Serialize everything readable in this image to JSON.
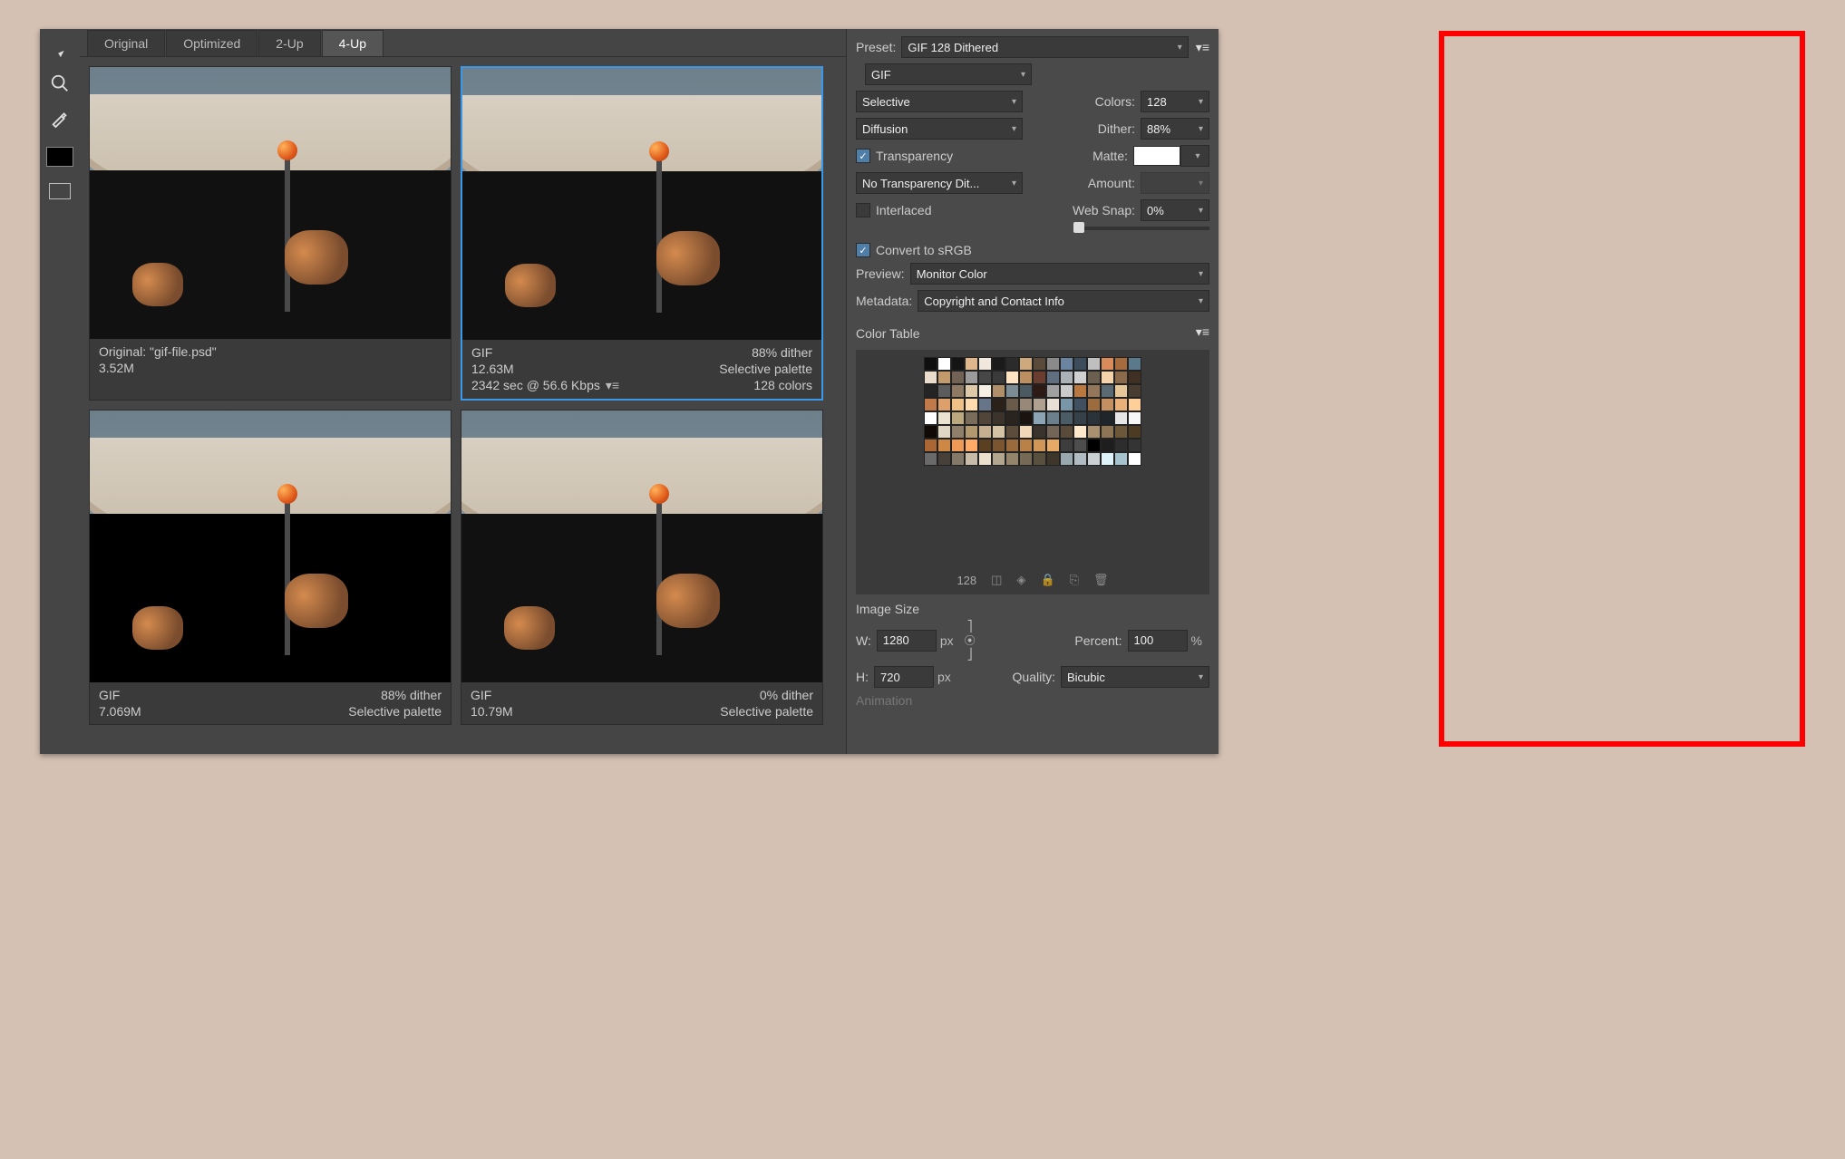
{
  "tabs": [
    "Original",
    "Optimized",
    "2-Up",
    "4-Up"
  ],
  "active_tab": 3,
  "previews": [
    {
      "title": "Original: \"gif-file.psd\"",
      "size": "3.52M",
      "time": "",
      "dither": "",
      "palette": "",
      "colors": ""
    },
    {
      "title": "GIF",
      "size": "12.63M",
      "time": "2342 sec @ 56.6 Kbps",
      "dither": "88% dither",
      "palette": "Selective palette",
      "colors": "128 colors"
    },
    {
      "title": "GIF",
      "size": "7.069M",
      "time": "",
      "dither": "88% dither",
      "palette": "Selective palette",
      "colors": ""
    },
    {
      "title": "GIF",
      "size": "10.79M",
      "time": "",
      "dither": "0% dither",
      "palette": "Selective palette",
      "colors": ""
    }
  ],
  "panel": {
    "preset_label": "Preset:",
    "preset": "GIF 128 Dithered",
    "format": "GIF",
    "reduction": "Selective",
    "colors_label": "Colors:",
    "colors": "128",
    "dither_algo": "Diffusion",
    "dither_label": "Dither:",
    "dither": "88%",
    "transparency": "Transparency",
    "matte_label": "Matte:",
    "trans_dither": "No Transparency Dit...",
    "amount_label": "Amount:",
    "interlaced": "Interlaced",
    "websnap_label": "Web Snap:",
    "websnap": "0%",
    "convert_srgb": "Convert to sRGB",
    "preview_label": "Preview:",
    "preview": "Monitor Color",
    "metadata_label": "Metadata:",
    "metadata": "Copyright and Contact Info",
    "colortable_label": "Color Table",
    "colortable_count": "128",
    "imagesize_label": "Image Size",
    "w_label": "W:",
    "w": "1280",
    "h_label": "H:",
    "h": "720",
    "px": "px",
    "percent_label": "Percent:",
    "percent": "100",
    "pct": "%",
    "quality_label": "Quality:",
    "quality": "Bicubic",
    "animation_label": "Animation"
  },
  "swatches": [
    "#0f0f0f",
    "#ffffff",
    "#141414",
    "#e0b68c",
    "#f0e8dc",
    "#1a1a1a",
    "#2b2b2b",
    "#cfa97e",
    "#5a4a3a",
    "#8a8a8a",
    "#6b85a0",
    "#3d4c5a",
    "#bfbfbf",
    "#d98c5a",
    "#a66b3d",
    "#5a7a8c",
    "#eaddcc",
    "#c29a6b",
    "#726256",
    "#9a9a9a",
    "#474747",
    "#3a3a3a",
    "#ffe4c4",
    "#bc8f60",
    "#6b3d2e",
    "#5f6f7f",
    "#aab2b8",
    "#d0d0d0",
    "#6b6050",
    "#f4d2aa",
    "#8a6a4a",
    "#3f3023",
    "#242424",
    "#5c5c5c",
    "#8e7a64",
    "#dec9a8",
    "#f5efe4",
    "#ae8f6a",
    "#7c8c94",
    "#4a5a60",
    "#2e1a14",
    "#a0a0a0",
    "#cacaca",
    "#b87840",
    "#93755a",
    "#5a6a72",
    "#e6c79a",
    "#493c30",
    "#c07a4a",
    "#dda06a",
    "#efc086",
    "#ffdcb0",
    "#66758a",
    "#2a2218",
    "#6a5a4a",
    "#988878",
    "#b0a090",
    "#e8e0d4",
    "#7896a8",
    "#405060",
    "#9c6c3e",
    "#c49060",
    "#eab07a",
    "#ffcf9a",
    "#ffffff",
    "#ece2d0",
    "#bba87f",
    "#7a6c5a",
    "#514438",
    "#3c332a",
    "#2a241e",
    "#1a1410",
    "#8aa4b4",
    "#6a808c",
    "#4c5c66",
    "#354048",
    "#2a323a",
    "#1e262c",
    "#e6e6e6",
    "#f7f7f7",
    "#100a06",
    "#e0d6c4",
    "#8f7f6a",
    "#b2986e",
    "#c4b090",
    "#d4c4a4",
    "#5c4c3a",
    "#f0d8b8",
    "#3a332c",
    "#736658",
    "#594a3a",
    "#ffe8cc",
    "#a89070",
    "#8c7454",
    "#6c5838",
    "#4c3c24",
    "#aa6633",
    "#cc8844",
    "#ee9955",
    "#ffaa66",
    "#5a4020",
    "#7a5530",
    "#9a6a3d",
    "#b98048",
    "#d09658",
    "#e6aa66",
    "#3d3d3d",
    "#4d4d4d",
    "#000000",
    "#1e1e1e",
    "#2d2d2d",
    "#343434",
    "#6a6a6a",
    "#464039",
    "#847868",
    "#c8bca8",
    "#eae0cc",
    "#b2a68e",
    "#93856c",
    "#766a54",
    "#5a503e",
    "#3e362a",
    "#98a8ae",
    "#b0bcc2",
    "#c8d0d4",
    "#def2fa",
    "#a6c2cc",
    "#ffffff"
  ]
}
